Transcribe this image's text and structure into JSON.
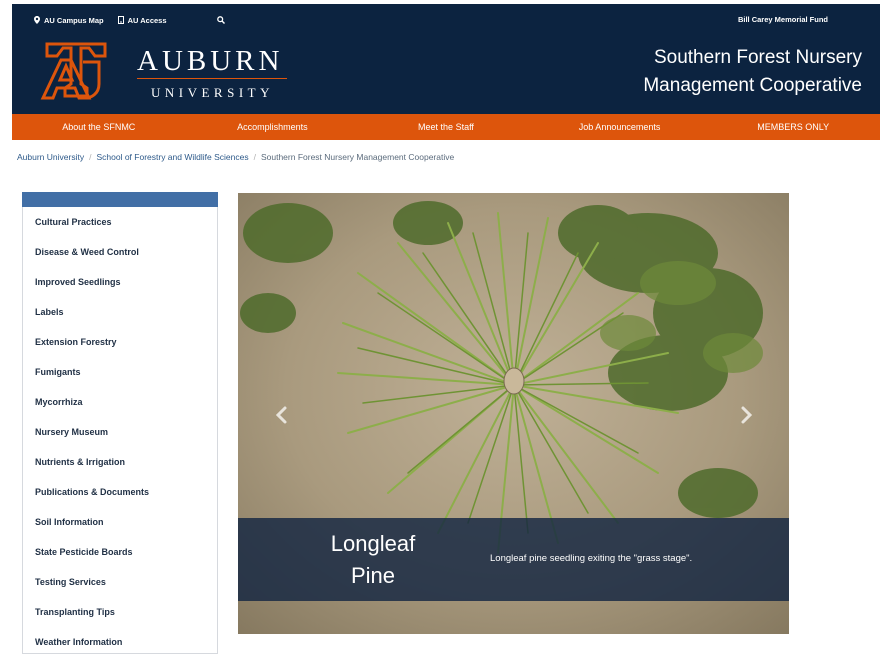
{
  "utility": {
    "campus_map": "AU Campus Map",
    "access": "AU Access",
    "memorial_fund": "Bill Carey Memorial Fund"
  },
  "logo": {
    "wordmark": "AUBURN",
    "university": "UNIVERSITY"
  },
  "site_title": {
    "line1": "Southern Forest Nursery",
    "line2": "Management Cooperative"
  },
  "nav": [
    {
      "label": "About the SFNMC"
    },
    {
      "label": "Accomplishments"
    },
    {
      "label": "Meet the Staff"
    },
    {
      "label": "Job Announcements"
    },
    {
      "label": "MEMBERS ONLY"
    }
  ],
  "breadcrumb": {
    "home": "Auburn University",
    "school": "School of Forestry and Wildlife Sciences",
    "current": "Southern Forest Nursery Management Cooperative"
  },
  "sidebar": {
    "items": [
      {
        "label": "Cultural Practices"
      },
      {
        "label": "Disease & Weed Control"
      },
      {
        "label": "Improved Seedlings"
      },
      {
        "label": "Labels"
      },
      {
        "label": "Extension Forestry"
      },
      {
        "label": "Fumigants"
      },
      {
        "label": "Mycorrhiza"
      },
      {
        "label": "Nursery Museum"
      },
      {
        "label": "Nutrients & Irrigation"
      },
      {
        "label": "Publications & Documents"
      },
      {
        "label": "Soil Information"
      },
      {
        "label": "State Pesticide Boards"
      },
      {
        "label": "Testing Services"
      },
      {
        "label": "Transplanting Tips"
      },
      {
        "label": "Weather Information"
      }
    ]
  },
  "slide": {
    "title_line1": "Longleaf",
    "title_line2": "Pine",
    "description": "Longleaf pine seedling exiting the \"grass stage\"."
  },
  "icons": {
    "campus_map": "map-pin-icon",
    "access": "lock-icon",
    "search": "search-icon",
    "prev": "chevron-left-icon",
    "next": "chevron-right-icon"
  },
  "colors": {
    "navy": "#0c2340",
    "orange": "#dd550c",
    "sidebar_header": "#426fa6"
  }
}
